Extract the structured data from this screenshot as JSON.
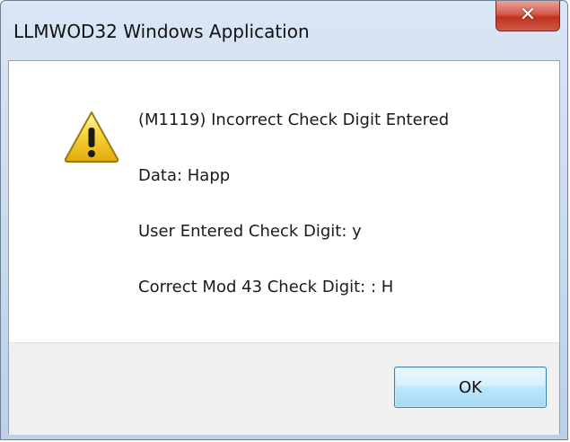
{
  "window": {
    "title": "LLMWOD32 Windows Application",
    "close_glyph": "✕"
  },
  "dialog": {
    "icon": "warning-icon",
    "lines": [
      "(M1119) Incorrect Check Digit Entered",
      "Data: Happ",
      "User Entered Check Digit: y",
      "Correct Mod 43 Check Digit: : H"
    ]
  },
  "buttons": {
    "ok_label": "OK"
  },
  "colors": {
    "titlebar": "#c8d9ee",
    "close_button": "#c0321f",
    "warning_fill": "#f5c518",
    "footer": "#f0f0f0",
    "ok_border": "#3c7fb1"
  }
}
